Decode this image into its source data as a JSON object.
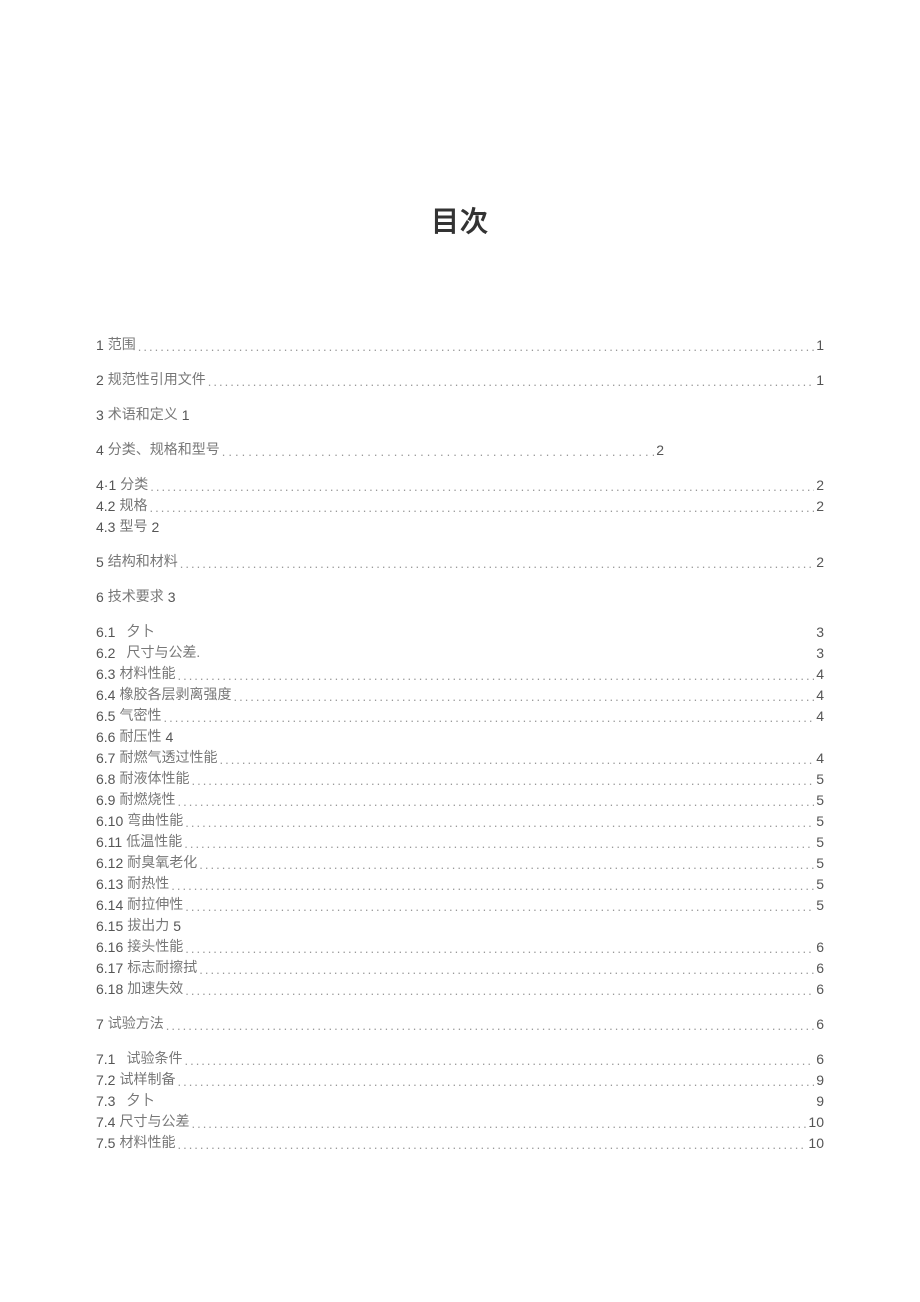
{
  "title": "目次",
  "entries": [
    {
      "num": "1",
      "label": "范围",
      "page": "1",
      "leader": true,
      "gapAfter": "lg"
    },
    {
      "num": "2",
      "label": "规范性引用文件",
      "page": "1",
      "leader": true,
      "gapAfter": "lg"
    },
    {
      "num": "3",
      "label": "术语和定义",
      "page": "1",
      "leader": false,
      "inlinePage": true,
      "gapAfter": "lg"
    },
    {
      "num": "4",
      "label": "分类、规格和型号",
      "page": "2",
      "leader": true,
      "short": true,
      "sparse": true,
      "gapAfter": "lg"
    },
    {
      "num": "4·1",
      "label": "分类",
      "page": "2",
      "leader": true,
      "gapAfter": "xs"
    },
    {
      "num": "4.2",
      "label": "规格",
      "page": "2",
      "leader": true,
      "gapAfter": "xs"
    },
    {
      "num": "4.3",
      "label": "型号",
      "page": "2",
      "leader": false,
      "inlinePage": true,
      "gapAfter": "lg"
    },
    {
      "num": "5",
      "label": "结构和材料",
      "page": "2",
      "leader": true,
      "gapAfter": "lg"
    },
    {
      "num": "6",
      "label": "技术要求",
      "page": "3",
      "leader": false,
      "inlinePage": true,
      "gapAfter": "lg"
    },
    {
      "num": "6.1",
      "label": "夕卜",
      "page": "3",
      "leader": false,
      "gapAfter": "xs",
      "indentLabel": true
    },
    {
      "num": "6.2",
      "label": "尺寸与公差.",
      "page": "3",
      "leader": false,
      "gapAfter": "xs",
      "indentLabel": true
    },
    {
      "num": "6.3",
      "label": "材料性能",
      "page": "4",
      "leader": true,
      "gapAfter": "xs"
    },
    {
      "num": "6.4",
      "label": "橡胶各层剥离强度",
      "page": "4",
      "leader": true,
      "gapAfter": "xs"
    },
    {
      "num": "6.5",
      "label": "气密性",
      "page": "4",
      "leader": true,
      "gapAfter": "xs"
    },
    {
      "num": "6.6",
      "label": "耐压性",
      "page": "4",
      "leader": false,
      "inlinePage": true,
      "gapAfter": "xs"
    },
    {
      "num": "6.7",
      "label": "耐燃气透过性能",
      "page": "4",
      "leader": true,
      "gapAfter": "xs"
    },
    {
      "num": "6.8",
      "label": "耐液体性能",
      "page": "5",
      "leader": true,
      "gapAfter": "xs"
    },
    {
      "num": "6.9",
      "label": "耐燃烧性",
      "page": "5",
      "leader": true,
      "gapAfter": "xs"
    },
    {
      "num": "6.10",
      "label": "弯曲性能",
      "page": "5",
      "leader": true,
      "gapAfter": "xs"
    },
    {
      "num": "6.11",
      "label": "低温性能",
      "page": "5",
      "leader": true,
      "gapAfter": "xs"
    },
    {
      "num": "6.12",
      "label": "耐臭氧老化",
      "page": "5",
      "leader": true,
      "gapAfter": "xs"
    },
    {
      "num": "6.13",
      "label": "耐热性",
      "page": "5",
      "leader": true,
      "gapAfter": "xs"
    },
    {
      "num": "6.14",
      "label": "耐拉伸性",
      "page": "5",
      "leader": true,
      "gapAfter": "xs"
    },
    {
      "num": "6.15",
      "label": "拔出力",
      "page": "5",
      "leader": false,
      "inlinePage": true,
      "gapAfter": "xs"
    },
    {
      "num": "6.16",
      "label": "接头性能",
      "page": "6",
      "leader": true,
      "gapAfter": "xs"
    },
    {
      "num": "6.17",
      "label": "标志耐擦拭",
      "page": "6",
      "leader": true,
      "gapAfter": "xs"
    },
    {
      "num": "6.18",
      "label": "加速失效",
      "page": "6",
      "leader": true,
      "gapAfter": "lg"
    },
    {
      "num": "7",
      "label": "试验方法",
      "page": "6",
      "leader": true,
      "gapAfter": "lg"
    },
    {
      "num": "7.1",
      "label": "试验条件",
      "page": "6",
      "leader": true,
      "gapAfter": "xs",
      "indentLabel": true
    },
    {
      "num": "7.2",
      "label": "试样制备",
      "page": "9",
      "leader": true,
      "gapAfter": "xs"
    },
    {
      "num": "7.3",
      "label": "夕卜",
      "page": "9",
      "leader": false,
      "gapAfter": "xs",
      "indentLabel": true
    },
    {
      "num": "7.4",
      "label": "尺寸与公差",
      "page": "10",
      "leader": true,
      "gapAfter": "xs"
    },
    {
      "num": "7.5",
      "label": "材料性能",
      "page": "10",
      "leader": true,
      "gapAfter": "xs"
    }
  ]
}
